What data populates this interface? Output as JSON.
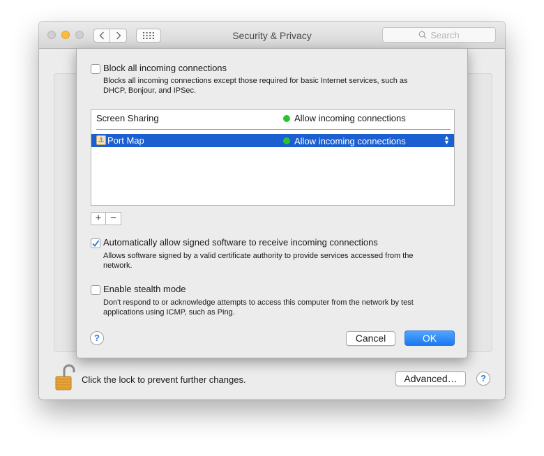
{
  "window": {
    "title": "Security & Privacy",
    "search_placeholder": "Search"
  },
  "sheet": {
    "block_all": {
      "checked": false,
      "label": "Block all incoming connections",
      "description_line1": "Blocks all incoming connections except those required for basic Internet services,  such as",
      "description_line2": "DHCP, Bonjour, and IPSec."
    },
    "apps": [
      {
        "name": "Screen Sharing",
        "status": "Allow incoming connections",
        "status_color": "#2ac52b",
        "selected": false
      },
      {
        "name": "Port Map",
        "status": "Allow incoming connections",
        "status_color": "#2ac52b",
        "selected": true,
        "icon": "anchor-icon"
      }
    ],
    "add_label": "+",
    "remove_label": "−",
    "auto_allow": {
      "checked": true,
      "label": "Automatically allow signed software to receive incoming connections",
      "description_line1": "Allows software signed by a valid certificate authority to provide services accessed from the",
      "description_line2": "network."
    },
    "stealth": {
      "checked": false,
      "label": "Enable stealth mode",
      "description_line1": "Don't respond to or acknowledge attempts to access this computer from the network by test",
      "description_line2": "applications using ICMP, such as Ping."
    },
    "help_label": "?",
    "cancel_label": "Cancel",
    "ok_label": "OK"
  },
  "footer": {
    "lock_text": "Click the lock to prevent further changes.",
    "advanced_label": "Advanced…",
    "help_label": "?"
  },
  "colors": {
    "accent": "#1b5fd0",
    "ok_button": "#1a7af0",
    "minimize": "#fdbc40",
    "status_green": "#2ac52b"
  }
}
